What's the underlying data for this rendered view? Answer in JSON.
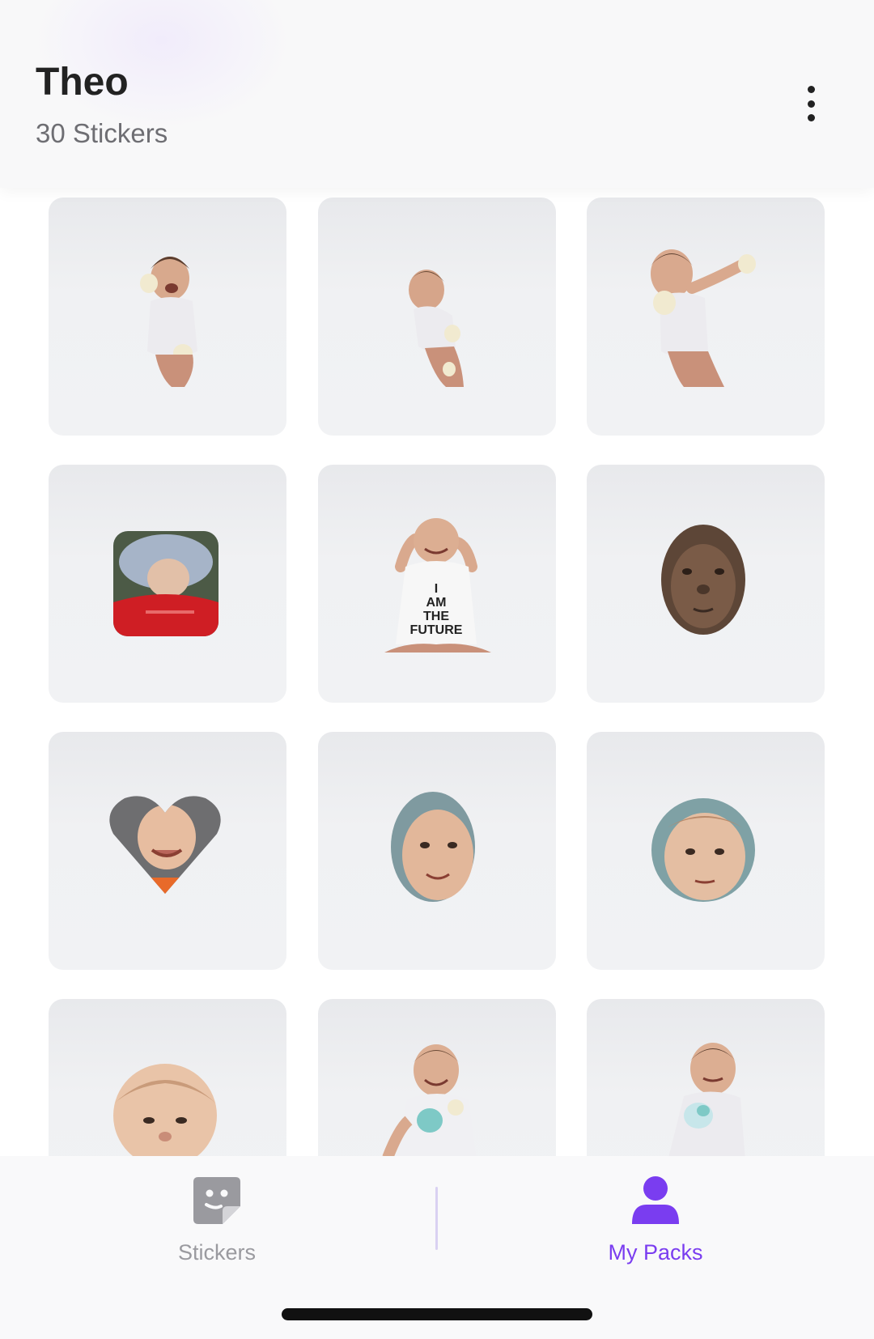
{
  "header": {
    "title": "Theo",
    "subtitle": "30 Stickers",
    "menu_icon": "more-vertical-icon"
  },
  "stickers": [
    {
      "shape": "baby-cutout",
      "pose": "laughing-standing"
    },
    {
      "shape": "baby-cutout",
      "pose": "standing-lean"
    },
    {
      "shape": "baby-cutout",
      "pose": "arm-raised"
    },
    {
      "shape": "rounded-square",
      "pose": "sleeping-red-blanket"
    },
    {
      "shape": "baby-cutout",
      "pose": "arms-up-onesie",
      "text": "I AM THE FUTURE"
    },
    {
      "shape": "oval",
      "pose": "face-closeup-dark"
    },
    {
      "shape": "heart",
      "pose": "smiling-face"
    },
    {
      "shape": "oval",
      "pose": "face-smile"
    },
    {
      "shape": "circle",
      "pose": "face-neutral"
    },
    {
      "shape": "circle",
      "pose": "face-closeup"
    },
    {
      "shape": "baby-cutout",
      "pose": "laughing-sitting"
    },
    {
      "shape": "baby-cutout",
      "pose": "sleepy-sitting"
    }
  ],
  "tabbar": {
    "tabs": [
      {
        "label": "Stickers",
        "icon": "sticker-icon",
        "active": false
      },
      {
        "label": "My Packs",
        "icon": "person-icon",
        "active": true
      }
    ]
  },
  "colors": {
    "accent": "#7a3df0",
    "inactive": "#9a9a9f",
    "tile_bg": "#f1f2f4"
  }
}
